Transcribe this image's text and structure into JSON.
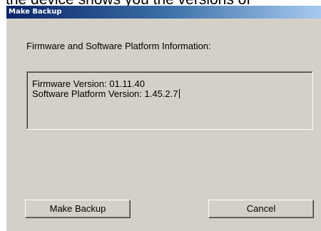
{
  "background_caption": "the device shows you the versions of",
  "window": {
    "title": "Make Backup"
  },
  "content": {
    "heading": "Firmware and Software Platform Information:",
    "info_lines": [
      "Firmware Version: 01.11.40",
      "Software Platform Version: 1.45.2.7"
    ]
  },
  "buttons": {
    "make_backup": "Make Backup",
    "cancel": "Cancel"
  },
  "colors": {
    "dialog_face": "#d4d0c8",
    "titlebar_start": "#0a246a",
    "titlebar_end": "#a6caf0"
  }
}
